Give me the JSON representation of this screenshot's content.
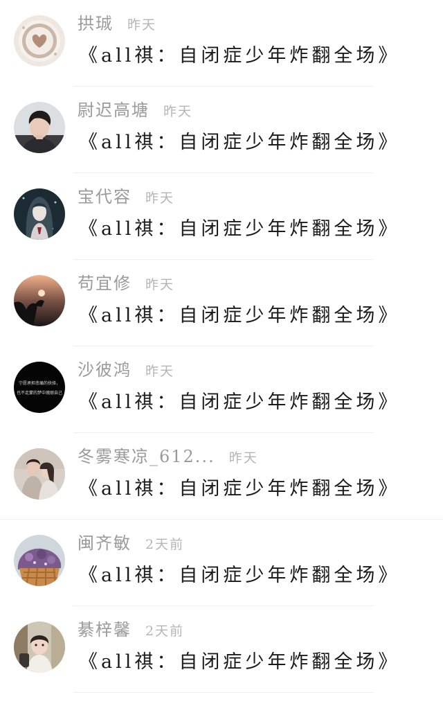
{
  "comments": [
    {
      "name": "拱珹",
      "time": "昨天",
      "text": "《all祺：自闭症少年炸翻全场》",
      "avatar_icon": "latte-art-heart-avatar"
    },
    {
      "name": "尉迟高塘",
      "time": "昨天",
      "text": "《all祺：自闭症少年炸翻全场》",
      "avatar_icon": "young-man-portrait-avatar"
    },
    {
      "name": "宝代容",
      "time": "昨天",
      "text": "《all祺：自闭症少年炸翻全场》",
      "avatar_icon": "anime-girl-avatar"
    },
    {
      "name": "苟宜修",
      "time": "昨天",
      "text": "《all祺：自闭症少年炸翻全场》",
      "avatar_icon": "sunset-silhouette-avatar"
    },
    {
      "name": "沙彼鸿",
      "time": "昨天",
      "text": "《all祺：自闭症少年炸翻全场》",
      "avatar_icon": "black-text-avatar",
      "avatar_text": [
        "宁愿承担悲痛的抉择，",
        "也不走蒙的梦中瑰丽自己"
      ]
    },
    {
      "name": "冬雾寒凉_612...",
      "time": "昨天",
      "text": "《all祺：自闭症少年炸翻全场》",
      "avatar_icon": "couple-photo-avatar"
    },
    {
      "name": "闽齐敏",
      "time": "2天前",
      "text": "《all祺：自闭症少年炸翻全场》",
      "avatar_icon": "ice-cream-waffle-avatar"
    },
    {
      "name": "綦梓馨",
      "time": "2天前",
      "text": "《all祺：自闭症少年炸翻全场》",
      "avatar_icon": "child-photo-avatar"
    }
  ],
  "colors": {
    "name": "#9a9a9a",
    "time": "#b5b5b5",
    "text": "#1a1a1a",
    "divider": "#efefef"
  }
}
